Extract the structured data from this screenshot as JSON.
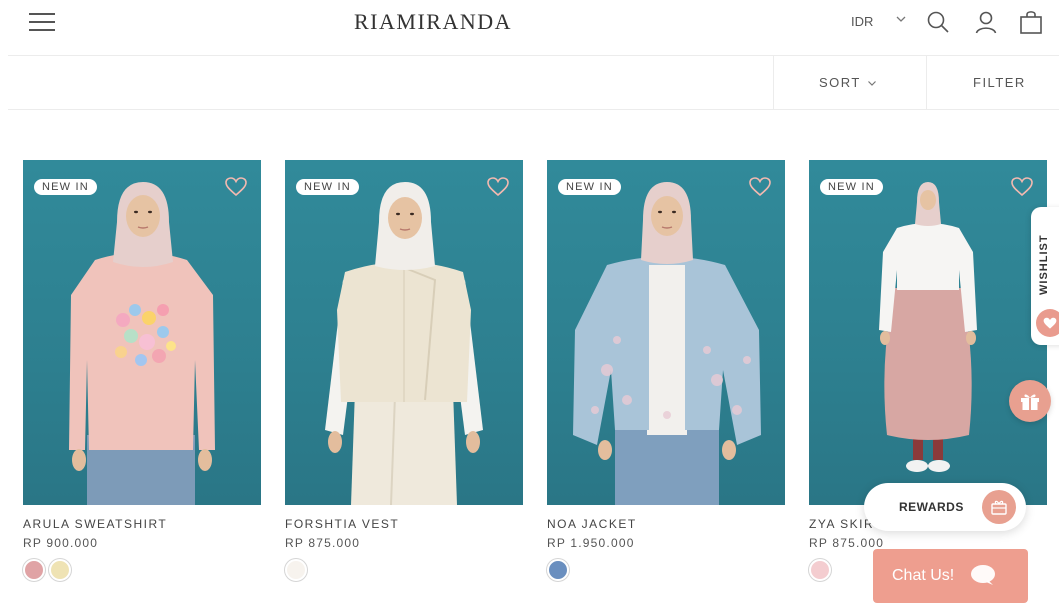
{
  "header": {
    "logo": "RIAMIRANDA",
    "currency": "IDR"
  },
  "toolbar": {
    "sort_label": "SORT",
    "filter_label": "FILTER"
  },
  "products": [
    {
      "badge": "NEW IN",
      "title": "ARULA SWEATSHIRT",
      "price": "RP 900.000",
      "swatches": [
        "#e0a3a5",
        "#efe3b4"
      ]
    },
    {
      "badge": "NEW IN",
      "title": "FORSHTIA VEST",
      "price": "RP 875.000",
      "swatches": [
        "#f7f3ee"
      ]
    },
    {
      "badge": "NEW IN",
      "title": "NOA JACKET",
      "price": "RP 1.950.000",
      "swatches": [
        "#6a8fbf"
      ]
    },
    {
      "badge": "NEW IN",
      "title": "ZYA SKIR",
      "price": "RP 875.000",
      "swatches": [
        "#f4cdd0"
      ]
    }
  ],
  "widgets": {
    "wishlist": "WISHLIST",
    "rewards": "REWARDS",
    "chat": "Chat Us!"
  },
  "colors": {
    "accent": "#ee9e8f",
    "photo_background": "#2f8797"
  }
}
